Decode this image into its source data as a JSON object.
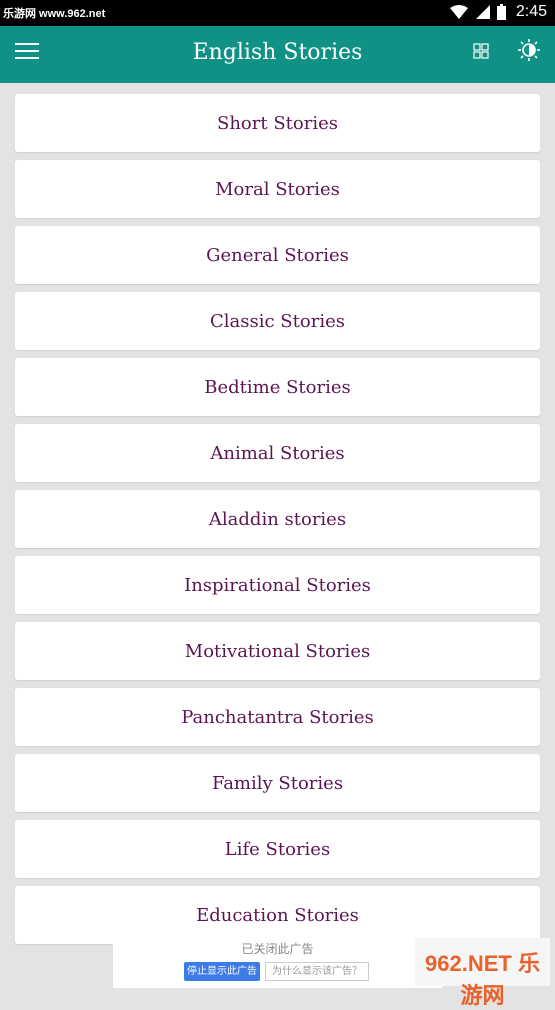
{
  "status_bar": {
    "watermark": "乐游网 www.962.net",
    "time": "2:45"
  },
  "app_bar": {
    "title": "English Stories"
  },
  "categories": [
    "Short Stories",
    "Moral Stories",
    "General Stories",
    "Classic Stories",
    "Bedtime Stories",
    "Animal Stories",
    "Aladdin stories",
    "Inspirational Stories",
    "Motivational Stories",
    "Panchatantra Stories",
    "Family Stories",
    "Life Stories",
    "Education Stories"
  ],
  "ad": {
    "closed_text": "已关闭此广告",
    "stop_button": "停止显示此广告",
    "why_button": "为什么显示该广告？"
  },
  "watermark_logo": "962.NET 乐游网",
  "colors": {
    "app_bar": "#0f9186",
    "item_text": "#5b1552",
    "background": "#e3e3e3"
  }
}
